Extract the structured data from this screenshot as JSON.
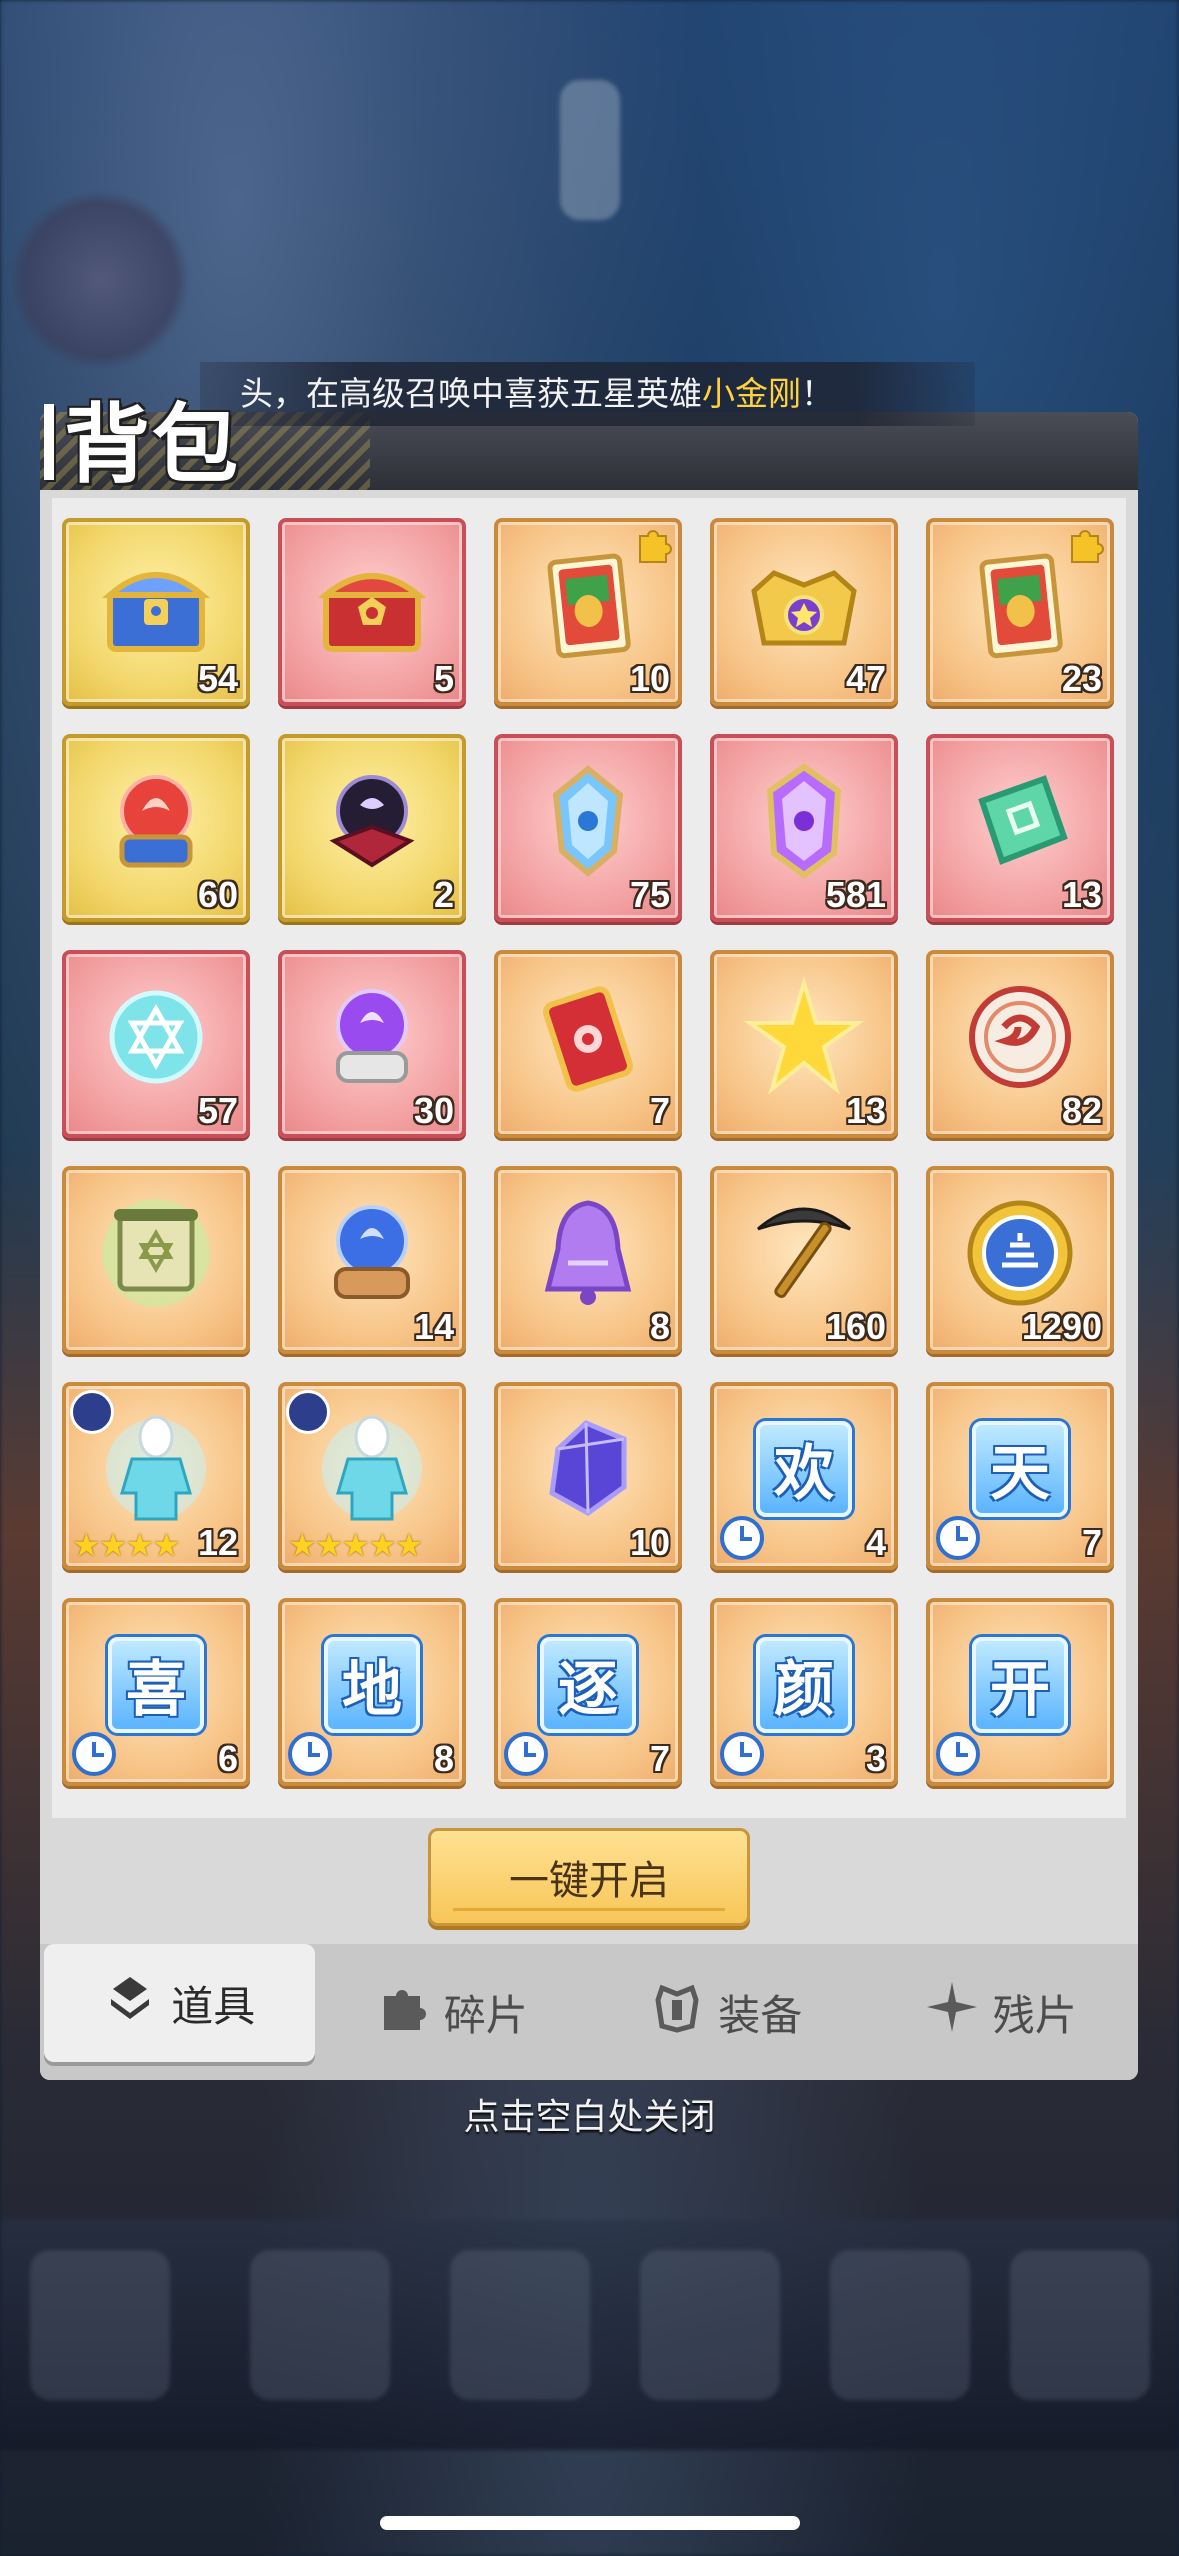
{
  "notice": {
    "prefix": "头，在高级召唤中喜获五星英雄",
    "highlight": "小金刚",
    "suffix": "！"
  },
  "title": "背包",
  "items": [
    {
      "icon": "blue-gold-treasure-chest-icon",
      "count": "54",
      "bg": "gold"
    },
    {
      "icon": "red-treasure-chest-icon",
      "count": "5",
      "bg": "red"
    },
    {
      "icon": "hero-card-fragment-icon",
      "count": "10",
      "bg": "orange",
      "puzzle": true
    },
    {
      "icon": "gold-purple-chest-icon",
      "count": "47",
      "bg": "orange"
    },
    {
      "icon": "hero-card-fragment-icon",
      "count": "23",
      "bg": "orange",
      "puzzle": true
    },
    {
      "icon": "red-orb-stand-icon",
      "count": "60",
      "bg": "gold"
    },
    {
      "icon": "dark-orb-stand-icon",
      "count": "2",
      "bg": "gold"
    },
    {
      "icon": "blue-crystal-icon",
      "count": "75",
      "bg": "red"
    },
    {
      "icon": "purple-crystal-icon",
      "count": "581",
      "bg": "red"
    },
    {
      "icon": "green-ticket-icon",
      "count": "13",
      "bg": "red"
    },
    {
      "icon": "hexagram-orb-icon",
      "count": "57",
      "bg": "red"
    },
    {
      "icon": "purple-orb-stand-icon",
      "count": "30",
      "bg": "red"
    },
    {
      "icon": "red-envelope-ticket-icon",
      "count": "7",
      "bg": "orange"
    },
    {
      "icon": "gold-star-icon",
      "count": "13",
      "bg": "orange"
    },
    {
      "icon": "dragon-medal-icon",
      "count": "82",
      "bg": "orange"
    },
    {
      "icon": "scroll-icon",
      "count": "",
      "bg": "orange"
    },
    {
      "icon": "blue-orb-stand-icon",
      "count": "14",
      "bg": "orange"
    },
    {
      "icon": "purple-bell-icon",
      "count": "8",
      "bg": "orange"
    },
    {
      "icon": "pickaxe-icon",
      "count": "160",
      "bg": "orange"
    },
    {
      "icon": "gold-coin-icon",
      "count": "1290",
      "bg": "orange"
    },
    {
      "icon": "hero-silhouette-icon",
      "count": "12",
      "bg": "orange",
      "stars": "★★★★",
      "corner": true
    },
    {
      "icon": "hero-silhouette-icon",
      "count": "",
      "bg": "orange",
      "stars": "★★★★★",
      "corner": true
    },
    {
      "icon": "purple-gem-icon",
      "count": "10",
      "bg": "orange"
    },
    {
      "icon": "word-tile-icon",
      "word": "欢",
      "count": "4",
      "bg": "orange",
      "clock": true
    },
    {
      "icon": "word-tile-icon",
      "word": "天",
      "count": "7",
      "bg": "orange",
      "clock": true
    },
    {
      "icon": "word-tile-icon",
      "word": "喜",
      "count": "6",
      "bg": "orange",
      "clock": true
    },
    {
      "icon": "word-tile-icon",
      "word": "地",
      "count": "8",
      "bg": "orange",
      "clock": true
    },
    {
      "icon": "word-tile-icon",
      "word": "逐",
      "count": "7",
      "bg": "orange",
      "clock": true
    },
    {
      "icon": "word-tile-icon",
      "word": "颜",
      "count": "3",
      "bg": "orange",
      "clock": true
    },
    {
      "icon": "word-tile-icon",
      "word": "开",
      "count": "",
      "bg": "orange",
      "clock": true
    }
  ],
  "open_button": "一键开启",
  "tabs": [
    {
      "label": "道具",
      "icon": "item-bag-icon",
      "active": true
    },
    {
      "label": "碎片",
      "icon": "puzzle-icon",
      "active": false
    },
    {
      "label": "装备",
      "icon": "armor-icon",
      "active": false
    },
    {
      "label": "残片",
      "icon": "shard-star-icon",
      "active": false
    }
  ],
  "close_hint": "点击空白处关闭",
  "colors": {
    "highlight": "#ffd23e",
    "slot_orange": "#f7c487",
    "slot_red": "#f3a1a2",
    "slot_gold": "#f2d66a"
  }
}
